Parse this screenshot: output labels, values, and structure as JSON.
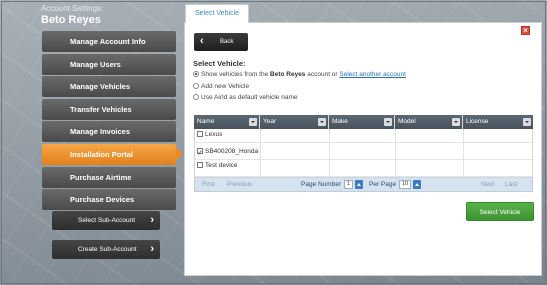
{
  "sidebar": {
    "title": "Account Settings:",
    "user_name": "Beto Reyes",
    "items": [
      {
        "label": "Manage Account Info"
      },
      {
        "label": "Manage Users"
      },
      {
        "label": "Manage Vehicles"
      },
      {
        "label": "Transfer Vehicles"
      },
      {
        "label": "Manage Invoices"
      },
      {
        "label": "Installation Portal",
        "active": true
      },
      {
        "label": "Purchase Airtime"
      },
      {
        "label": "Purchase Devices"
      }
    ],
    "select_sub_account": "Select Sub-Account",
    "create_sub_account": "Create Sub-Account"
  },
  "main": {
    "tab_label": "Select Vehicle",
    "back_label": "Back",
    "heading": "Select Vehicle:",
    "options": {
      "show_prefix": "Show vehicles from the",
      "account_name": "Beto Reyes",
      "show_suffix": "account  or",
      "another_account_link": "Select another account",
      "add_new": "Add new Vehicle",
      "use_airid": "Use AirId as default vehicle name"
    },
    "table": {
      "columns": [
        "Name",
        "Year",
        "Make",
        "Model",
        "License"
      ],
      "rows": [
        {
          "name": "Lexus",
          "checked": false
        },
        {
          "name": "SB400208_Honda",
          "checked": true
        },
        {
          "name": "Test device",
          "checked": false
        }
      ]
    },
    "pager": {
      "first": "First",
      "previous": "Previous",
      "page_number_label": "Page Number",
      "page_number": "1",
      "per_page_label": "Per Page",
      "per_page": "10",
      "next": "Next",
      "last": "Last"
    },
    "select_button": "Select Vehicle"
  },
  "colors": {
    "active_menu": "#e88a25",
    "menu_item": "#555555",
    "accent_link": "#2a6fc2",
    "select_button": "#4ba23e",
    "close_icon": "#e24b3b"
  }
}
